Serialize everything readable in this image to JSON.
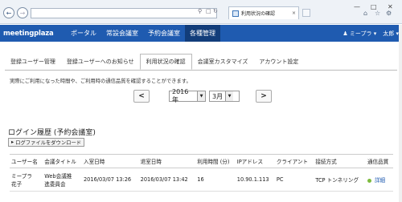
{
  "browser": {
    "tab_title": "利用状況の確認"
  },
  "topnav": {
    "logo": "meetingplaza",
    "items": [
      "ポータル",
      "常設会議室",
      "予約会議室",
      "各種管理"
    ],
    "user1": "ミープラ",
    "user2": "太郎"
  },
  "subtabs": [
    "登録ユーザー管理",
    "登録ユーザーへのお知らせ",
    "利用状況の確認",
    "会議室カスタマイズ",
    "アカウント設定"
  ],
  "notice": "実際にご利用になった時間や、ご利用時の通信品質を確認することができます。",
  "date": {
    "year": "2016年",
    "month": "3月",
    "prev": "<",
    "next": ">"
  },
  "section_title": "ログイン履歴 (予約会議室)",
  "download_label": "ログファイルをダウンロード",
  "table": {
    "headers": [
      "ユーザー名",
      "会議タイトル",
      "入室日時",
      "退室日時",
      "利用時間 (分)",
      "IPアドレス",
      "クライアント",
      "接続方式",
      "通信品質"
    ],
    "rows": [
      [
        "ミープラ\n花子",
        "Web会議推\n進委員会",
        "2016/03/07 13:26",
        "2016/03/07 13:42",
        "16",
        "10.90.1.113",
        "PC",
        "TCP トンネリング",
        "詳細"
      ]
    ]
  },
  "colors": {
    "nav": "#1f5bb0",
    "nav_active": "#123d7a",
    "quality_good": "#7dbb3e"
  }
}
